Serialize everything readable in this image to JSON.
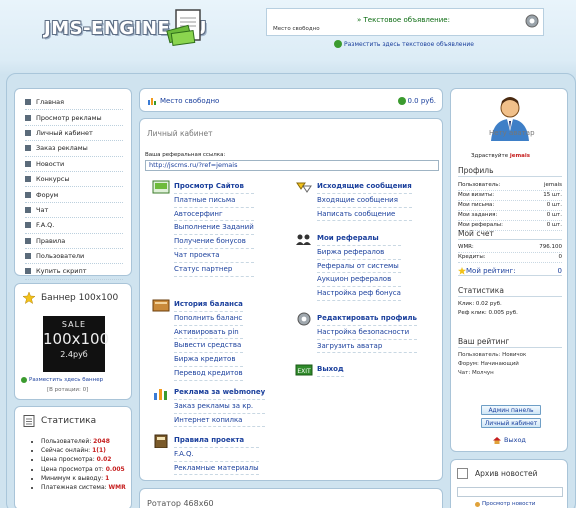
{
  "header": {
    "logo_text": "JMS-ENGINE.RU",
    "ad_free_label": "Место свободно",
    "ad_title": "» Текстовое объявление:",
    "ad_place_link": "Разместить здесь текстовое объявление"
  },
  "menu": {
    "items": [
      "Главная",
      "Просмотр рекламы",
      "Личный кабинет",
      "Заказ рекламы",
      "Новости",
      "Конкурсы",
      "Форум",
      "Чат",
      "F.A.Q.",
      "Правила",
      "Пользователи",
      "Купить скрипт"
    ]
  },
  "banner": {
    "title": "Баннер 100x100",
    "ad_line1": "SALE",
    "ad_line2": "100x100",
    "ad_line3": "2.4руб",
    "place_link": "Разместить здесь баннер",
    "rotation": "[В ротации: 0]"
  },
  "stats_left": {
    "title": "Статистика",
    "items": [
      {
        "label": "Пользователей: ",
        "value": "2048"
      },
      {
        "label": "Сейчас онлайн: ",
        "value": "1(1)"
      },
      {
        "label": "Цена просмотра: ",
        "value": "0.02"
      },
      {
        "label": "Цена просмотра от: ",
        "value": "0.005"
      },
      {
        "label": "Минимум к выводу: ",
        "value": "1"
      },
      {
        "label": "Платежная система: ",
        "value": "WMR"
      }
    ]
  },
  "topbar": {
    "counter_text": "Место свободно",
    "balance_text": "0.0 руб."
  },
  "cabinet": {
    "title": "Личный кабинет",
    "ref_label": "Ваша реферальная ссылка:",
    "ref_link": "http://jscms.ru/?ref=jemais",
    "sections_left": [
      {
        "icon": "surfing-icon",
        "lines": [
          "Просмотр Сайтов",
          "Платные письма",
          "Автосерфинг",
          "Выполнение Заданий",
          "Получение бонусов",
          "Чат проекта",
          "Статус партнер"
        ]
      },
      {
        "icon": "history-icon",
        "lines": [
          "История баланса",
          "Пополнить баланс",
          "Активировать pin",
          "Вывести средства",
          "Биржа кредитов",
          "Перевод кредитов"
        ]
      },
      {
        "icon": "chart-icon",
        "lines": [
          "Реклама за webmoney",
          "Заказ рекламы за кр.",
          "Интернет копилка"
        ]
      },
      {
        "icon": "rules-book-icon",
        "lines": [
          "Правила проекта",
          "F.A.Q.",
          "Рекламные материалы"
        ]
      }
    ],
    "sections_right": [
      {
        "icon": "messages-icon",
        "lines": [
          "Исходящие сообщения",
          "Входящие сообщения",
          "Написать сообщение"
        ]
      },
      {
        "icon": "referrals-icon",
        "lines": [
          "Мои рефералы",
          "Биржа рефералов",
          "Рефералы от системы",
          "Аукцион рефералов",
          "Настройка реф бонуса"
        ]
      },
      {
        "icon": "settings-icon",
        "lines": [
          "Редактировать профиль",
          "Настройка безопасности",
          "Загрузить аватар"
        ]
      },
      {
        "icon": "exit-icon",
        "lines": [
          "Выход"
        ]
      }
    ]
  },
  "rotator": {
    "title": "Ротатор 468x60"
  },
  "profile": {
    "no_avatar": "Нету аватар",
    "hello_label": "Здраствуйте",
    "username": "jemais",
    "profile_title": "Профиль",
    "profile_rows": [
      {
        "k": "Пользователь:",
        "v": "jemais"
      },
      {
        "k": "Мои визиты:",
        "v": "15 шт."
      },
      {
        "k": "Мои письма:",
        "v": "0 шт."
      },
      {
        "k": "Мои задания:",
        "v": "0 шт."
      },
      {
        "k": "Мои рефералы:",
        "v": "0 шт."
      }
    ],
    "account_title": "Мой счет",
    "account_rows": [
      {
        "k": "WMR:",
        "v": "796.100"
      },
      {
        "k": "Кредиты:",
        "v": "0"
      }
    ],
    "rating_label": "Мой рейтинг:",
    "rating_value": "0",
    "stat_title": "Статистика",
    "stat_lines": [
      "Клик: 0.02 руб.",
      "Реф клик: 0.005 руб."
    ],
    "status_title": "Ваш рейтинг",
    "status_lines": [
      "Пользователь: Новичок",
      "Форум: Начинающий",
      "Чат: Молчун"
    ],
    "admin_button": "Админ панель",
    "cabinet_button": "Личный кабинет",
    "logout": "Выход"
  },
  "archive": {
    "title": "Архив новостей",
    "view_link": "Просмотр новости"
  },
  "colors": {
    "link": "#1a3f9c",
    "accent_red": "#c62020",
    "frame": "#cfe3ef"
  }
}
